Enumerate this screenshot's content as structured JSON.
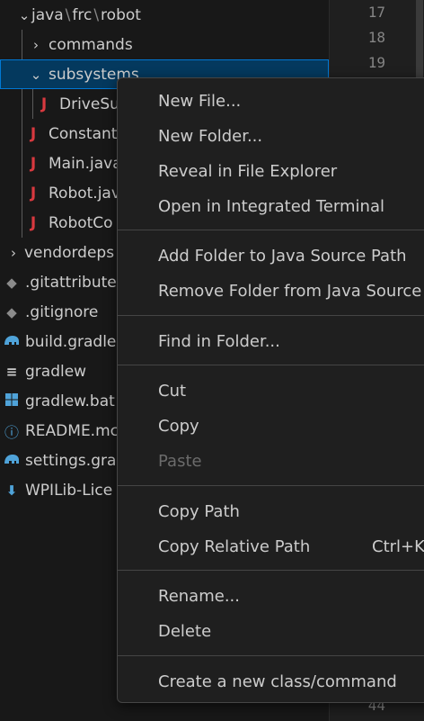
{
  "explorer": {
    "items": [
      {
        "label": "java",
        "path_parts": [
          "frc",
          "robot"
        ],
        "chevron": "chevron-down",
        "icon": ""
      },
      {
        "label": "commands",
        "chevron": "chevron-right",
        "icon": ""
      },
      {
        "label": "subsystems",
        "chevron": "chevron-down",
        "icon": "",
        "selected": true
      },
      {
        "label": "DriveSu",
        "icon": "java"
      },
      {
        "label": "Constant",
        "icon": "java"
      },
      {
        "label": "Main.java",
        "icon": "java"
      },
      {
        "label": "Robot.jav",
        "icon": "java"
      },
      {
        "label": "RobotCo",
        "icon": "java"
      },
      {
        "label": "vendordeps",
        "chevron": "chevron-right",
        "icon": ""
      },
      {
        "label": ".gitattribute",
        "icon": "git-diamond"
      },
      {
        "label": ".gitignore",
        "icon": "git-diamond"
      },
      {
        "label": "build.gradle",
        "icon": "gradle-elephant"
      },
      {
        "label": "gradlew",
        "icon": "text-lines"
      },
      {
        "label": "gradlew.bat",
        "icon": "windows-logo"
      },
      {
        "label": "README.mc",
        "icon": "info-circle"
      },
      {
        "label": "settings.gra",
        "icon": "gradle-elephant"
      },
      {
        "label": "WPILib-Lice",
        "icon": "download-arrow"
      }
    ]
  },
  "editor": {
    "line_numbers": [
      "17",
      "18",
      "19",
      "44"
    ]
  },
  "context_menu": {
    "groups": [
      [
        {
          "label": "New File..."
        },
        {
          "label": "New Folder..."
        },
        {
          "label": "Reveal in File Explorer"
        },
        {
          "label": "Open in Integrated Terminal"
        }
      ],
      [
        {
          "label": "Add Folder to Java Source Path"
        },
        {
          "label": "Remove Folder from Java Source P"
        }
      ],
      [
        {
          "label": "Find in Folder..."
        }
      ],
      [
        {
          "label": "Cut"
        },
        {
          "label": "Copy"
        },
        {
          "label": "Paste",
          "disabled": true
        }
      ],
      [
        {
          "label": "Copy Path"
        },
        {
          "label": "Copy Relative Path",
          "shortcut": "Ctrl+K"
        }
      ],
      [
        {
          "label": "Rename..."
        },
        {
          "label": "Delete"
        }
      ],
      [
        {
          "label": "Create a new class/command"
        }
      ]
    ]
  },
  "colors": {
    "background": "#181818",
    "selection": "#04395e",
    "focus_border": "#0078d4",
    "java_icon": "#d8393f",
    "accent_icon": "#4fa3d9",
    "menu_background": "#1f1f1f",
    "menu_border": "#454545",
    "disabled_text": "#6b6b6b"
  }
}
